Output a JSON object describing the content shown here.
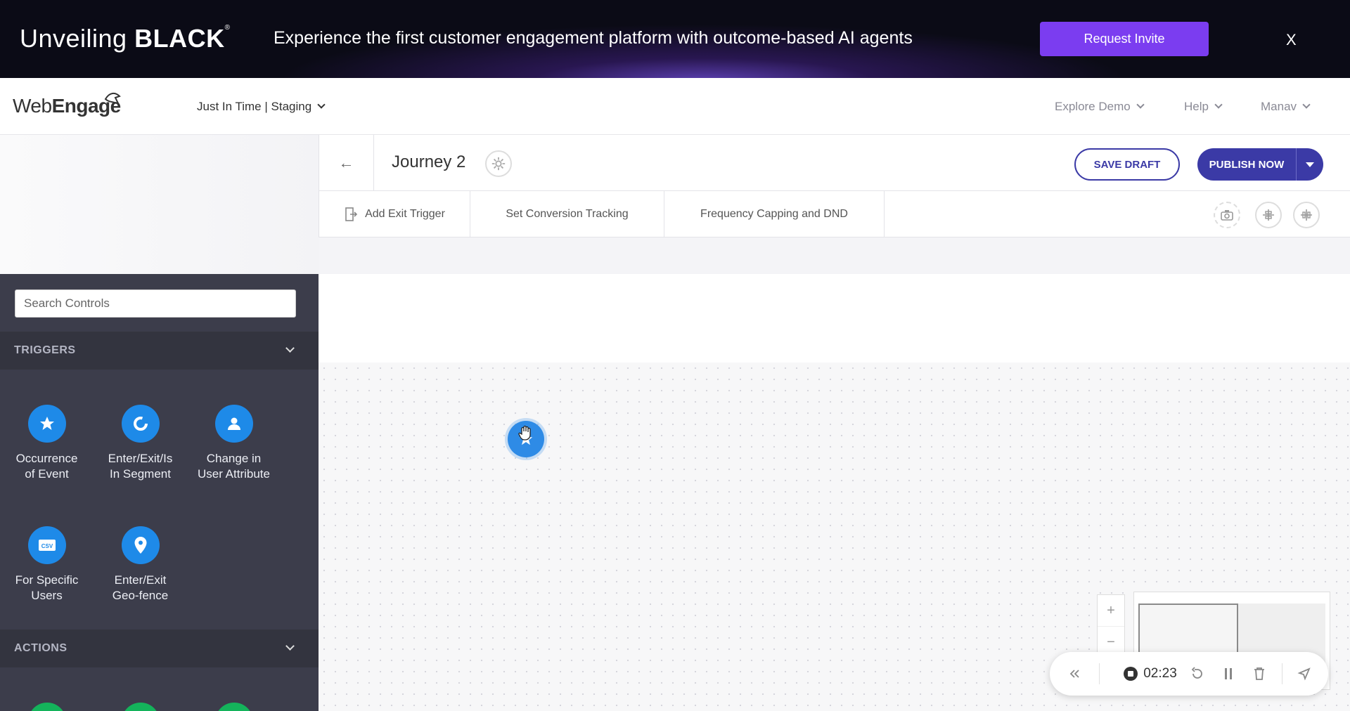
{
  "banner": {
    "brand_prefix": "Unveiling ",
    "brand_bold": "BLACK",
    "brand_mark": "®",
    "text": "Experience the first customer engagement platform with outcome-based AI agents",
    "button_label": "Request Invite",
    "close_label": "X"
  },
  "nav": {
    "logo_pre": "Web",
    "logo_bold": "Engage",
    "project": "Just In Time | Staging",
    "explore": "Explore Demo",
    "help": "Help",
    "user": "Manav"
  },
  "journey": {
    "back": "←",
    "title": "Journey 2",
    "save_draft": "SAVE DRAFT",
    "publish": "PUBLISH NOW"
  },
  "tabs": [
    "Add Exit Trigger",
    "Set Conversion Tracking",
    "Frequency Capping and DND"
  ],
  "sidebar": {
    "search_placeholder": "Search Controls",
    "triggers_title": "TRIGGERS",
    "actions_title": "ACTIONS",
    "triggers": [
      {
        "line1": "Occurrence",
        "line2": "of Event",
        "icon": "star-icon"
      },
      {
        "line1": "Enter/Exit/Is",
        "line2": "In Segment",
        "icon": "segment-icon"
      },
      {
        "line1": "Change in",
        "line2": "User Attribute",
        "icon": "user-icon"
      },
      {
        "line1": "For Specific",
        "line2": "Users",
        "icon": "csv-icon"
      },
      {
        "line1": "Enter/Exit",
        "line2": "Geo-fence",
        "icon": "location-pin-icon"
      }
    ],
    "csv_text": "CSV"
  },
  "zoom": {
    "plus": "+",
    "minus": "−"
  },
  "recorder": {
    "time": "02:23"
  },
  "colors": {
    "accent": "#3b3aa6",
    "banner_button": "#7b3df0",
    "trigger_blue": "#1e8ae8",
    "action_green": "#14b35b",
    "sidebar": "#3c3d4b"
  }
}
